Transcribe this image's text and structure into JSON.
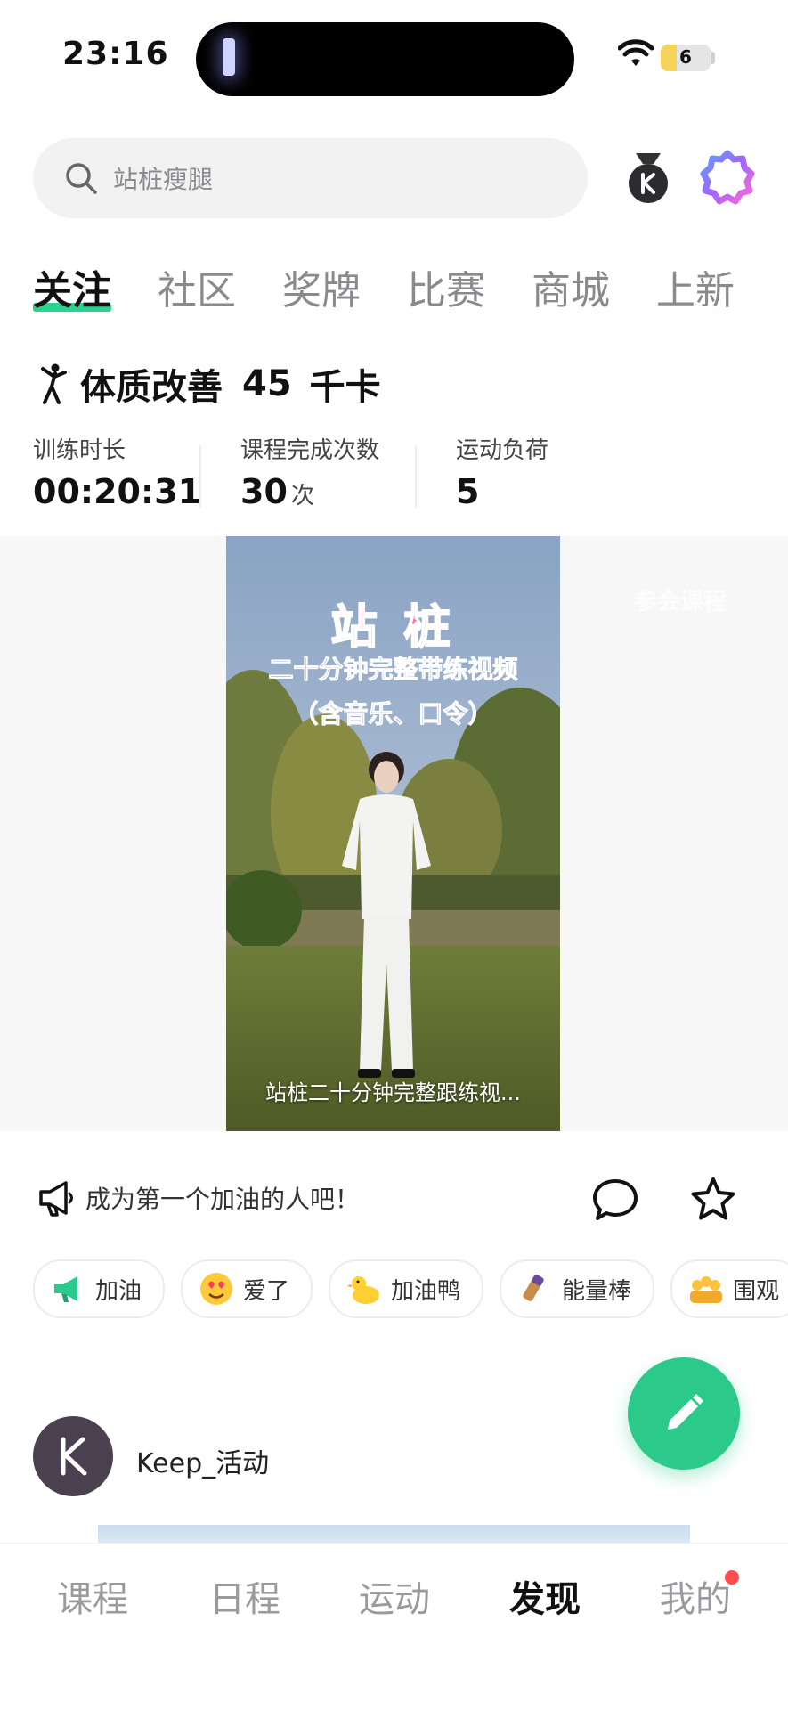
{
  "status_bar": {
    "time": "23:16",
    "battery": "6"
  },
  "search": {
    "placeholder": "站桩瘦腿"
  },
  "tabs": [
    {
      "label": "关注",
      "active": true
    },
    {
      "label": "社区"
    },
    {
      "label": "奖牌"
    },
    {
      "label": "比赛"
    },
    {
      "label": "商城"
    },
    {
      "label": "上新"
    }
  ],
  "workout": {
    "title": "体质改善",
    "calories": "45",
    "calories_unit": "千卡",
    "metrics": [
      {
        "label": "训练时长",
        "value": "00:20:31",
        "unit": ""
      },
      {
        "label": "课程完成次数",
        "value": "30",
        "unit": "次"
      },
      {
        "label": "运动负荷",
        "value": "5",
        "unit": ""
      }
    ]
  },
  "video": {
    "title_main": "站 桩",
    "title_sub1": "二十分钟完整带练视频",
    "title_sub2": "（含音乐、口令）",
    "caption": "站桩二十分钟完整跟练视...",
    "faded_label": "参会课程"
  },
  "actions": {
    "cheer_prompt": "成为第一个加油的人吧！"
  },
  "reactions": [
    {
      "label": "加油",
      "icon": "megaphone-icon"
    },
    {
      "label": "爱了",
      "icon": "heart-eyes-icon"
    },
    {
      "label": "加油鸭",
      "icon": "duck-icon"
    },
    {
      "label": "能量棒",
      "icon": "energy-bar-icon"
    },
    {
      "label": "围观",
      "icon": "crowd-icon"
    }
  ],
  "author": {
    "name": "Keep_活动"
  },
  "bottom_nav": [
    {
      "label": "课程"
    },
    {
      "label": "日程"
    },
    {
      "label": "运动"
    },
    {
      "label": "发现",
      "active": true
    },
    {
      "label": "我的",
      "badge": true
    }
  ],
  "colors": {
    "accent": "#2bc98a",
    "badge": "#ff4d4f"
  }
}
